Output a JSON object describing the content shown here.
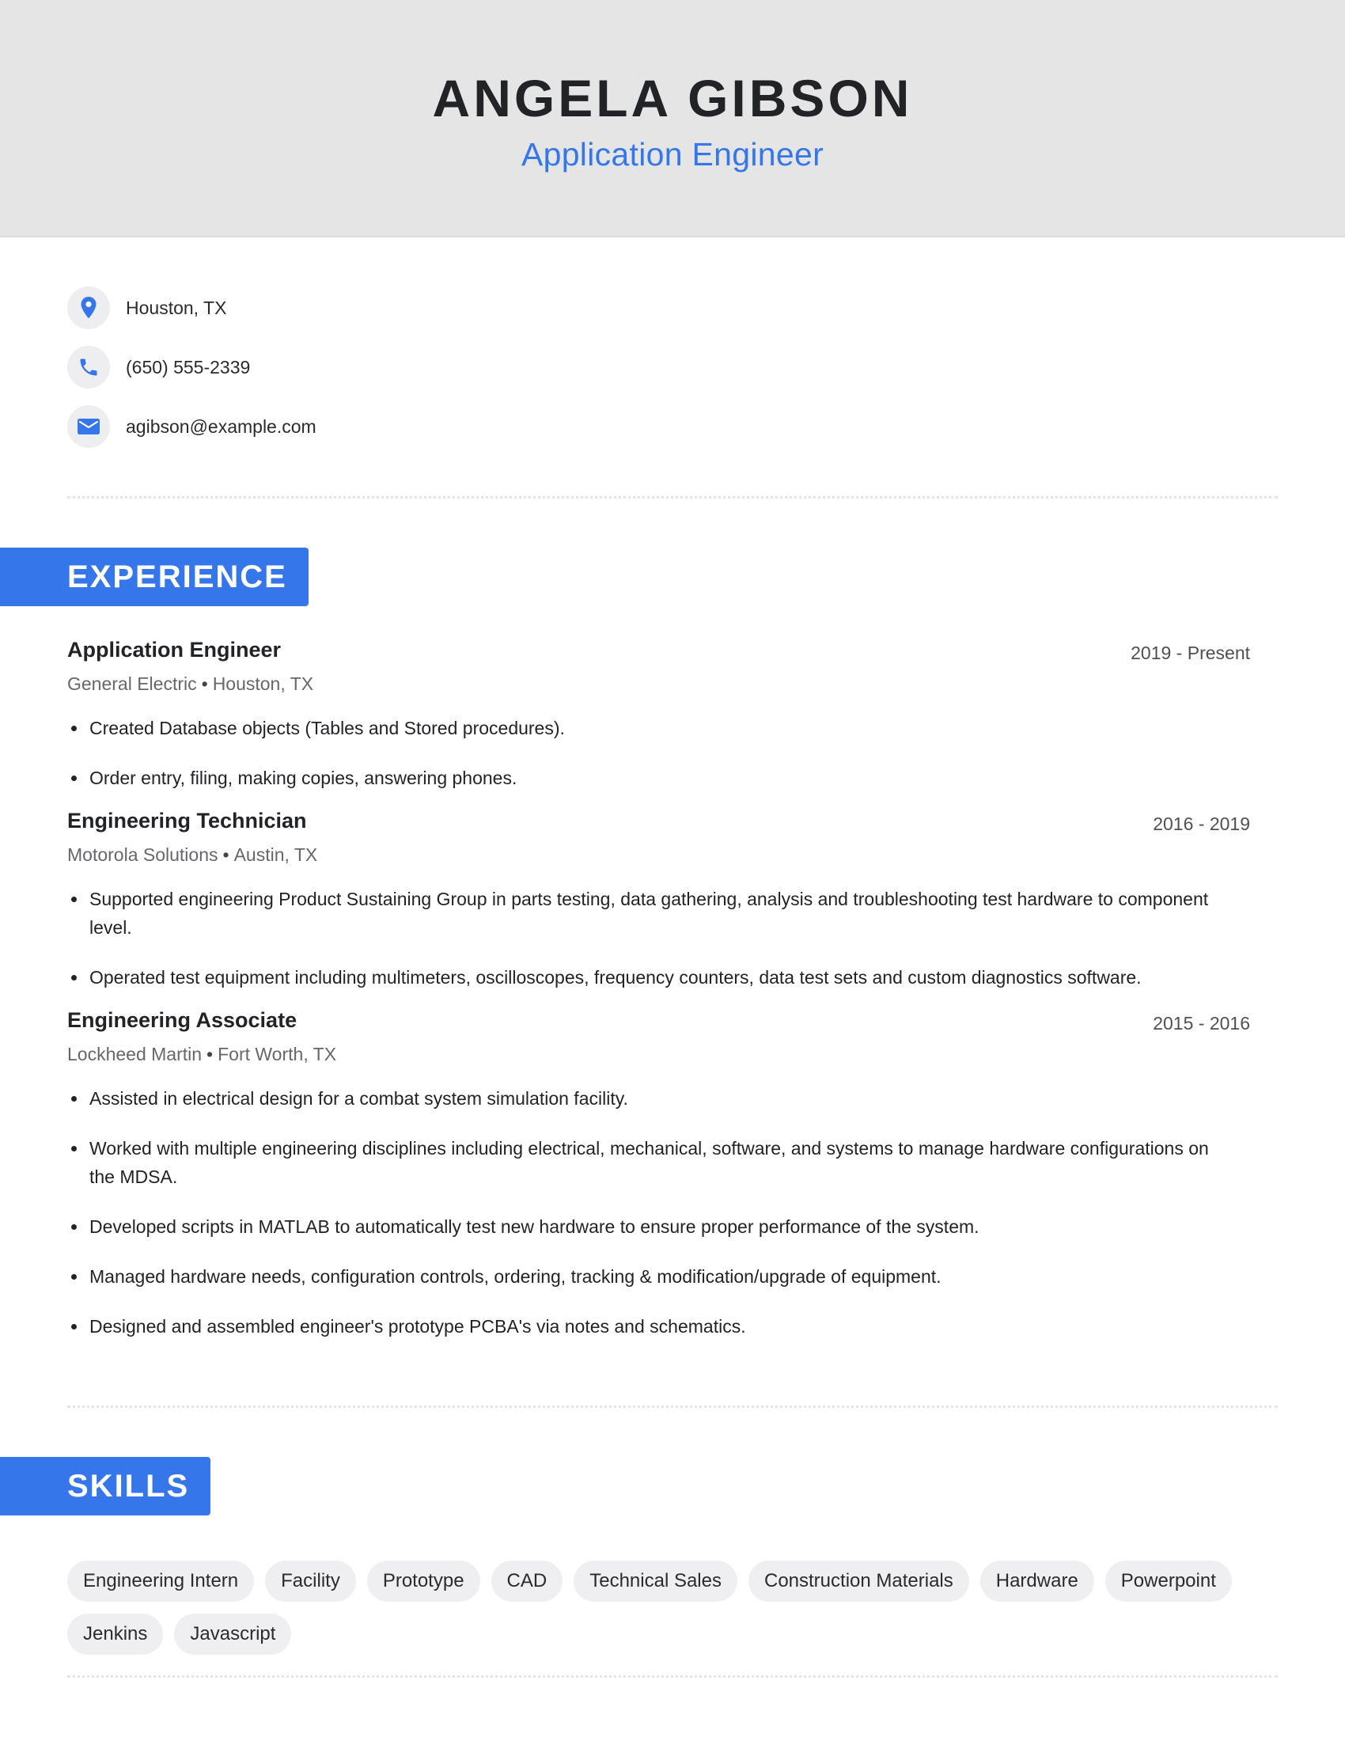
{
  "header": {
    "name": "ANGELA GIBSON",
    "title": "Application Engineer"
  },
  "contact": [
    {
      "icon": "location-pin-icon",
      "text": "Houston, TX"
    },
    {
      "icon": "phone-icon",
      "text": "(650) 555-2339"
    },
    {
      "icon": "email-icon",
      "text": "agibson@example.com"
    }
  ],
  "colors": {
    "accent": "#3577ea",
    "header_bg": "#e5e5e6",
    "pill_bg": "#efeff1",
    "text": "#222326"
  },
  "experience": {
    "heading": "EXPERIENCE",
    "jobs": [
      {
        "title": "Application Engineer",
        "dates": "2019 - Present",
        "company": "General Electric",
        "location": "Houston, TX",
        "bullets": [
          "Created Database objects (Tables and Stored procedures).",
          "Order entry, filing, making copies, answering phones."
        ]
      },
      {
        "title": "Engineering Technician",
        "dates": "2016 - 2019",
        "company": "Motorola Solutions",
        "location": "Austin, TX",
        "bullets": [
          "Supported engineering Product Sustaining Group in parts testing, data gathering, analysis and troubleshooting test hardware to component level.",
          "Operated test equipment including multimeters, oscilloscopes, frequency counters, data test sets and custom diagnostics software."
        ]
      },
      {
        "title": "Engineering Associate",
        "dates": "2015 - 2016",
        "company": "Lockheed Martin",
        "location": "Fort Worth, TX",
        "bullets": [
          "Assisted in electrical design for a combat system simulation facility.",
          "Worked with multiple engineering disciplines including electrical, mechanical, software, and systems to manage hardware configurations on the MDSA.",
          "Developed scripts in MATLAB to automatically test new hardware to ensure proper performance of the system.",
          "Managed hardware needs, configuration controls, ordering, tracking & modification/upgrade of equipment.",
          "Designed and assembled engineer's prototype PCBA's via notes and schematics."
        ]
      }
    ]
  },
  "skills": {
    "heading": "SKILLS",
    "items": [
      "Engineering Intern",
      "Facility",
      "Prototype",
      "CAD",
      "Technical Sales",
      "Construction Materials",
      "Hardware",
      "Powerpoint",
      "Jenkins",
      "Javascript"
    ]
  },
  "separator": "•"
}
